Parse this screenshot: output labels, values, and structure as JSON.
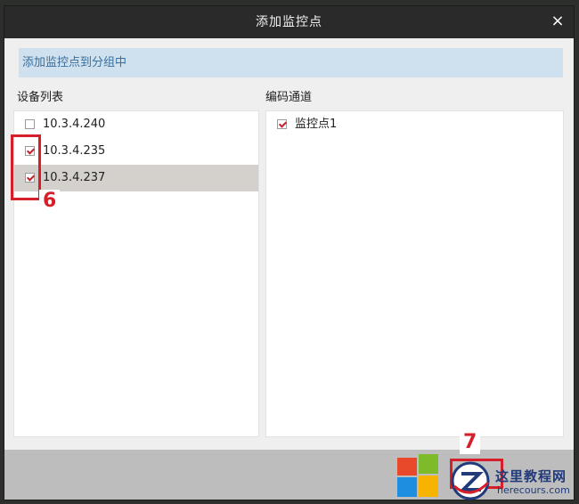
{
  "dialog": {
    "title": "添加监控点",
    "close_symbol": "×",
    "hint": "添加监控点到分组中"
  },
  "device_list": {
    "label": "设备列表",
    "items": [
      {
        "label": "10.3.4.240",
        "checked": false,
        "selected": false
      },
      {
        "label": "10.3.4.235",
        "checked": true,
        "selected": false
      },
      {
        "label": "10.3.4.237",
        "checked": true,
        "selected": true
      }
    ]
  },
  "channel_list": {
    "label": "编码通道",
    "items": [
      {
        "label": "监控点1",
        "checked": true
      }
    ]
  },
  "annotations": {
    "step6": "6",
    "step7": "7"
  },
  "watermark": {
    "brand_cn": "这里教程网",
    "brand_en": "herecours.com"
  },
  "colors": {
    "highlight": "#d51f2a",
    "hint_bg": "#cfe0ee",
    "hint_text": "#3a6f9c",
    "title_bg": "#2a2a2a"
  }
}
